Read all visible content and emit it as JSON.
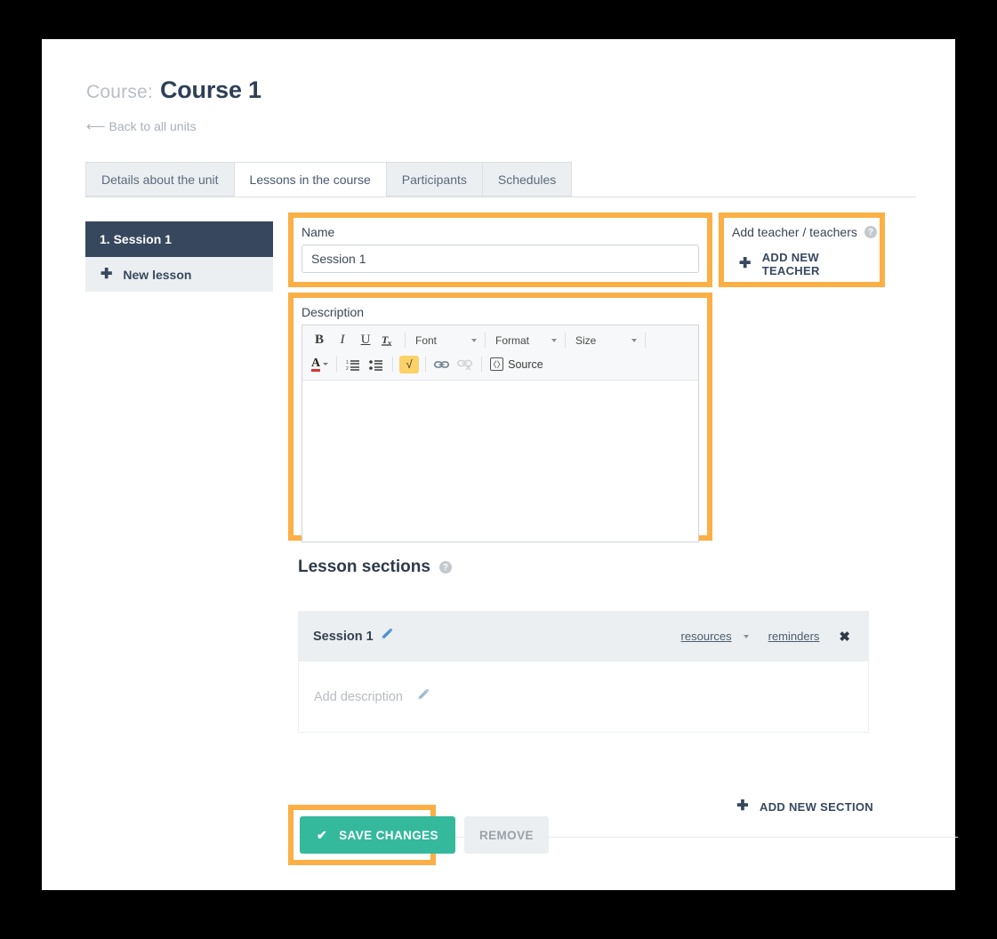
{
  "header": {
    "course_prefix": "Course:",
    "course_title": "Course 1",
    "back_link": "Back to all units",
    "back_arrow": "⟵"
  },
  "tabs": [
    {
      "label": "Details about the unit",
      "active": false
    },
    {
      "label": "Lessons in the course",
      "active": true
    },
    {
      "label": "Participants",
      "active": false
    },
    {
      "label": "Schedules",
      "active": false
    }
  ],
  "sidebar": {
    "lessons": [
      {
        "label": "1. Session 1"
      }
    ],
    "new_lesson_label": "New lesson",
    "plus": "✚"
  },
  "name_field": {
    "label": "Name",
    "value": "Session 1",
    "placeholder": "Name"
  },
  "teacher_panel": {
    "label": "Add teacher / teachers",
    "help_glyph": "?",
    "add_label": "ADD NEW TEACHER",
    "plus": "✚"
  },
  "description": {
    "label": "Description",
    "body_value": "",
    "toolbar": {
      "bold": "B",
      "italic": "I",
      "underline": "U",
      "remove_format": "Tx",
      "font": "Font",
      "format": "Format",
      "size": "Size",
      "text_color": "A",
      "numbered_list": "numbered-list",
      "bulleted_list": "bulleted-list",
      "math": "√",
      "link": "link",
      "unlink": "unlink",
      "source": "Source"
    }
  },
  "lesson_sections": {
    "title": "Lesson sections",
    "help_glyph": "?",
    "card": {
      "name": "Session 1",
      "resources_label": "resources",
      "reminders_label": "reminders",
      "close_glyph": "✖",
      "description_placeholder": "Add description"
    },
    "add_section_label": "ADD NEW SECTION",
    "add_section_plus": "✚"
  },
  "footer": {
    "save_label": "SAVE CHANGES",
    "save_check": "✔",
    "remove_label": "REMOVE"
  },
  "colors": {
    "accent_orange": "#fbaf45",
    "navy": "#37485e",
    "green": "#35b99d",
    "tab_gray": "#eceff1",
    "page_bg": "#000000"
  }
}
